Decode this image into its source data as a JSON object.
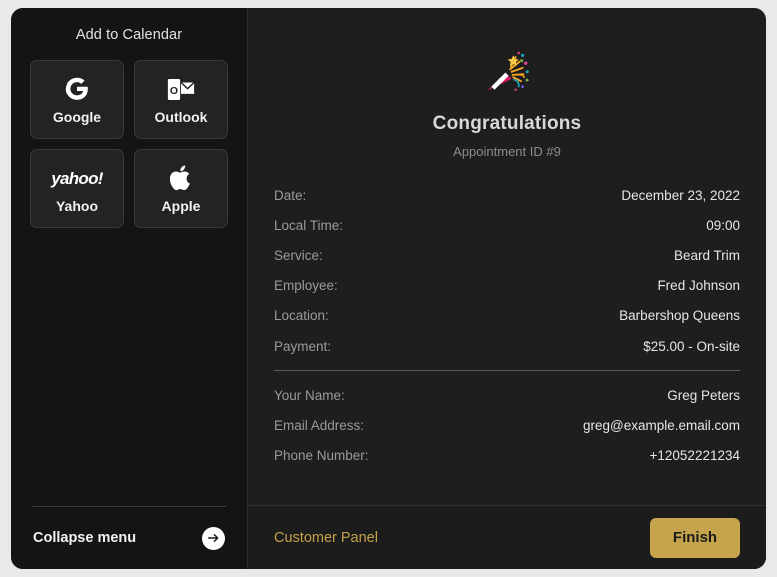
{
  "sidebar": {
    "title": "Add to Calendar",
    "calendar_buttons": [
      {
        "label": "Google",
        "icon": "google-icon"
      },
      {
        "label": "Outlook",
        "icon": "outlook-icon"
      },
      {
        "label": "Yahoo",
        "icon": "yahoo-icon",
        "wordmark": "yahoo!"
      },
      {
        "label": "Apple",
        "icon": "apple-icon"
      }
    ],
    "collapse_label": "Collapse menu",
    "collapse_icon": "arrow-right-circle-icon"
  },
  "main": {
    "status_icon": "party-popper-icon",
    "heading": "Congratulations",
    "subheading": "Appointment ID #9",
    "appointment_details": [
      {
        "label": "Date:",
        "value": "December 23, 2022"
      },
      {
        "label": "Local Time:",
        "value": "09:00"
      },
      {
        "label": "Service:",
        "value": "Beard Trim"
      },
      {
        "label": "Employee:",
        "value": "Fred Johnson"
      },
      {
        "label": "Location:",
        "value": "Barbershop Queens"
      },
      {
        "label": "Payment:",
        "value": "$25.00 - On-site"
      }
    ],
    "customer_details": [
      {
        "label": "Your Name:",
        "value": "Greg Peters"
      },
      {
        "label": "Email Address:",
        "value": "greg@example.email.com"
      },
      {
        "label": "Phone Number:",
        "value": "+12052221234"
      }
    ]
  },
  "footer": {
    "customer_panel_label": "Customer Panel",
    "finish_label": "Finish"
  },
  "colors": {
    "accent_gold": "#c5a44c",
    "page_background": "#e9e9e9",
    "sidebar_background": "#141414",
    "main_background": "#1e1e1e"
  }
}
